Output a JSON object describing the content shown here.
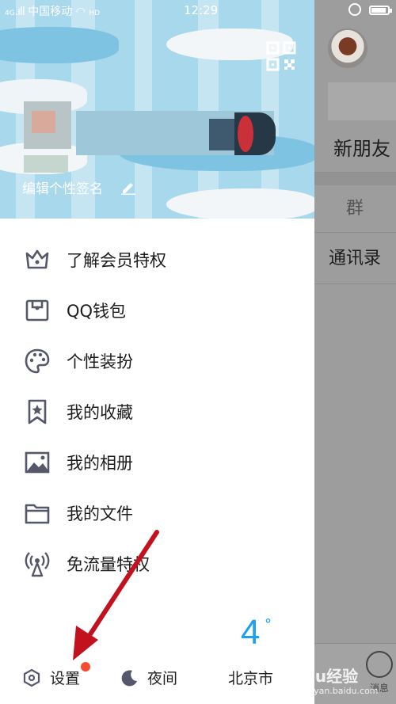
{
  "status_bar": {
    "carrier": "中国移动",
    "network": "4G",
    "hd": "HD",
    "time": "12:29",
    "battery_level": 0.9
  },
  "profile": {
    "signature": "编辑个性签名",
    "qr_icon": "qr-code-icon",
    "edit_icon": "pencil-icon"
  },
  "menu": [
    {
      "id": "vip",
      "label": "了解会员特权",
      "icon": "crown-icon"
    },
    {
      "id": "wallet",
      "label": "QQ钱包",
      "icon": "wallet-icon"
    },
    {
      "id": "theme",
      "label": "个性装扮",
      "icon": "palette-icon"
    },
    {
      "id": "favorites",
      "label": "我的收藏",
      "icon": "bookmark-star-icon"
    },
    {
      "id": "album",
      "label": "我的相册",
      "icon": "photo-icon"
    },
    {
      "id": "files",
      "label": "我的文件",
      "icon": "folder-icon"
    },
    {
      "id": "free-data",
      "label": "免流量特权",
      "icon": "signal-tower-icon"
    }
  ],
  "bottom": {
    "settings_label": "设置",
    "night_label": "夜间",
    "temperature": "4",
    "degree": "°",
    "city": "北京市"
  },
  "background": {
    "new_friends": "新朋友",
    "group": "群",
    "contacts": "通讯录",
    "tab_label": "消息",
    "watermark": "Baidu经验",
    "watermark_sub": "jingyan.baidu.com"
  },
  "colors": {
    "accent_blue": "#1aa0ef",
    "badge_red": "#f74c31",
    "header_bg": "#a8d8ec",
    "icon_gray": "#55586a",
    "annotation_arrow": "#c2121e"
  }
}
